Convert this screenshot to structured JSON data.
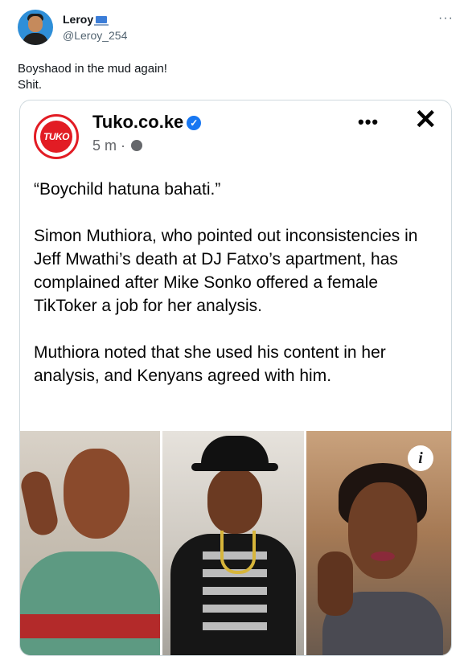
{
  "tweet": {
    "user_name": "Leroy",
    "user_handle": "@Leroy_254",
    "more_label": "···",
    "text_line1": "Boyshaod in the mud again!",
    "text_line2": "Shit."
  },
  "quoted_post": {
    "page_name": "Tuko.co.ke",
    "logo_text": "TUKO",
    "verified_label": "✓",
    "time": "5 m ·",
    "more_label": "•••",
    "close_label": "✕",
    "paragraphs": [
      "“Boychild hatuna bahati.”",
      "Simon Muthiora, who pointed out inconsistencies in Jeff Mwathi’s death at DJ Fatxo’s apartment, has complained after Mike Sonko offered a female TikToker a job for her analysis.",
      "Muthiora noted that she used his content in her analysis, and Kenyans agreed with him."
    ],
    "info_label": "i"
  },
  "icons": {
    "avatar": "avatar",
    "laptop": "laptop-icon",
    "verified": "verified-badge-icon",
    "globe": "globe-icon",
    "more": "more-icon",
    "close": "close-icon",
    "info": "info-icon"
  },
  "colors": {
    "tuko_red": "#e21c24",
    "verified_blue": "#1877f2",
    "handle_gray": "#536471"
  }
}
